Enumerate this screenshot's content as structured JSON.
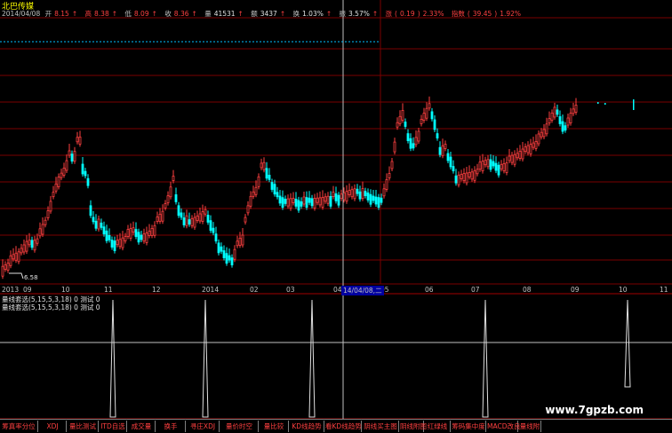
{
  "header": {
    "stock_name": "北巴传媒",
    "date": "2014/04/08",
    "open_label": "开",
    "open": "8.15",
    "high_label": "高",
    "high": "8.38",
    "low_label": "低",
    "low": "8.09",
    "close_label": "收",
    "close": "8.36",
    "volume_label": "量",
    "volume": "41531",
    "amount_label": "额",
    "amount": "3437",
    "turnover_label": "换",
    "turnover": "1.03%",
    "amplitude_label": "振",
    "amplitude": "3.57%",
    "change_label": "涨",
    "change": "0.19",
    "change_pct": "2.33%",
    "index_label": "指数",
    "index_change": "39.45",
    "index_change_pct": "1.92%"
  },
  "price_chart": {
    "low_marker": "6.58"
  },
  "time_axis": {
    "labels": [
      "2013",
      "09",
      "10",
      "11",
      "12",
      "2014",
      "02",
      "03",
      "04",
      "05",
      "06",
      "07",
      "08",
      "09",
      "10",
      "11"
    ],
    "cursor_date": "14/04/08,二"
  },
  "indicator1": {
    "title": "量线套选(5,15,5,3,18) 0",
    "value_label": "测试 0"
  },
  "indicator2": {
    "title": "量线套选(5,15,5,3,18) 0",
    "value_label": "测试 0"
  },
  "tabs": [
    "筹真率分位",
    "XDJ",
    "量比测试",
    "ITD自选",
    "成交量",
    "换手",
    "寻庄XDJ",
    "量价时空",
    "量比较",
    "KD线趋势",
    "看KD线趋势",
    "阴线买主图",
    "阴线附图",
    "红绿线",
    "筹码集中度",
    "MACD改良",
    "量线附"
  ],
  "watermark": "www.7gpzb.com",
  "colors": {
    "up": "#ff4040",
    "down": "#00ffff",
    "grid": "#8b0000",
    "cursor": "#c0c0c0"
  }
}
